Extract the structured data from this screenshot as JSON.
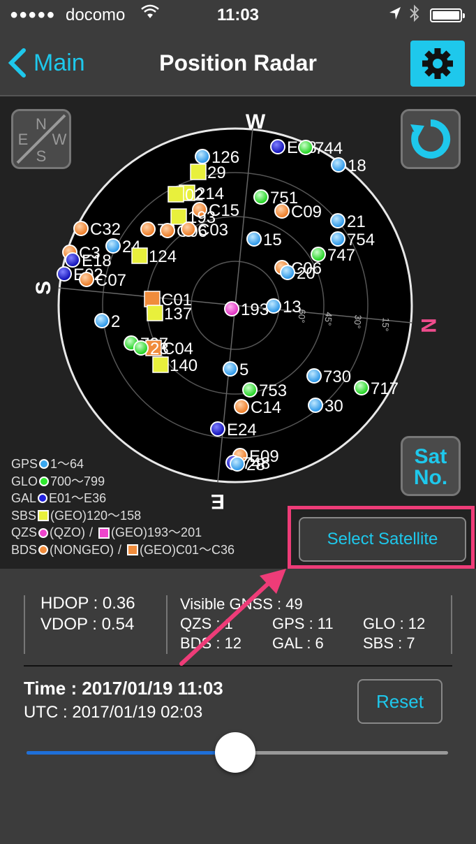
{
  "status_bar": {
    "signal": "●●●●●",
    "carrier": "docomo",
    "time": "11:03"
  },
  "nav": {
    "back_label": "Main",
    "title": "Position Radar",
    "settings_icon": "gear-icon"
  },
  "radar": {
    "directions": {
      "top": "W",
      "right": "N",
      "bottom": "E",
      "left": "S"
    },
    "elevation_labels": [
      "60°",
      "45°",
      "30°",
      "15°"
    ],
    "compass_button_letters": {
      "n": "N",
      "e": "E",
      "s": "S",
      "w": "W"
    },
    "satno_label_1": "Sat",
    "satno_label_2": "No.",
    "satellites": [
      {
        "label": "126",
        "type": "gps"
      },
      {
        "label": "E08",
        "type": "gal"
      },
      {
        "label": "744",
        "type": "glo"
      },
      {
        "label": "18",
        "type": "gps"
      },
      {
        "label": "29",
        "type": "sbs"
      },
      {
        "label": "214",
        "type": "sbs"
      },
      {
        "label": "02",
        "type": "sbs"
      },
      {
        "label": "751",
        "type": "glo"
      },
      {
        "label": "C15",
        "type": "bds"
      },
      {
        "label": "193",
        "type": "sbs"
      },
      {
        "label": "C09",
        "type": "bds"
      },
      {
        "label": "21",
        "type": "gps"
      },
      {
        "label": "C32",
        "type": "bds"
      },
      {
        "label": "73",
        "type": "bds"
      },
      {
        "label": "C06",
        "type": "bds"
      },
      {
        "label": "C03",
        "type": "bds"
      },
      {
        "label": "15",
        "type": "gps"
      },
      {
        "label": "754",
        "type": "gps"
      },
      {
        "label": "C3",
        "type": "bds"
      },
      {
        "label": "E18",
        "type": "gal"
      },
      {
        "label": "24",
        "type": "gps"
      },
      {
        "label": "124",
        "type": "sbs"
      },
      {
        "label": "747",
        "type": "glo"
      },
      {
        "label": "E02",
        "type": "gal"
      },
      {
        "label": "C07",
        "type": "bds"
      },
      {
        "label": "C06",
        "type": "bds"
      },
      {
        "label": "20",
        "type": "gps"
      },
      {
        "label": "C01",
        "type": "bds_geo"
      },
      {
        "label": "137",
        "type": "sbs"
      },
      {
        "label": "193",
        "type": "qzs_geo"
      },
      {
        "label": "13",
        "type": "gps"
      },
      {
        "label": "2",
        "type": "gps"
      },
      {
        "label": "727",
        "type": "glo"
      },
      {
        "label": "C04",
        "type": "bds_geo"
      },
      {
        "label": "23",
        "type": "glo"
      },
      {
        "label": "140",
        "type": "sbs"
      },
      {
        "label": "5",
        "type": "gps"
      },
      {
        "label": "730",
        "type": "gps"
      },
      {
        "label": "30",
        "type": "gps"
      },
      {
        "label": "717",
        "type": "glo"
      },
      {
        "label": "753",
        "type": "glo"
      },
      {
        "label": "C14",
        "type": "bds"
      },
      {
        "label": "E24",
        "type": "gal"
      },
      {
        "label": "E09",
        "type": "bds"
      },
      {
        "label": "748",
        "type": "gal"
      },
      {
        "label": "28",
        "type": "gps"
      }
    ]
  },
  "legend": {
    "gps": {
      "name": "GPS",
      "range": "1〜64"
    },
    "glo": {
      "name": "GLO",
      "range": "700〜799"
    },
    "gal": {
      "name": "GAL",
      "range": "E01〜E36"
    },
    "sbs": {
      "name": "SBS",
      "range": "(GEO)120〜158"
    },
    "qzs": {
      "name": "QZS",
      "range1": "(QZO)",
      "sep": "/",
      "range2": "(GEO)193〜201"
    },
    "bds": {
      "name": "BDS",
      "range1": "(NONGEO)",
      "sep": "/",
      "range2": "(GEO)C01〜C36"
    }
  },
  "select_satellite_label": "Select Satellite",
  "stats": {
    "hdop": "HDOP : 0.36",
    "vdop": "VDOP : 0.54",
    "visible": "Visible GNSS : 49",
    "qzs": "QZS : 1",
    "gps": "GPS : 11",
    "glo": "GLO : 12",
    "bds": "BDS : 12",
    "gal": "GAL : 6",
    "sbs": "SBS : 7"
  },
  "time_label": "Time : 2017/01/19 11:03",
  "utc_label": "UTC : 2017/01/19 02:03",
  "reset_label": "Reset",
  "time_slider": {
    "value": 0.5
  },
  "colors": {
    "accent": "#1ec8ec",
    "highlight": "#ee3c78",
    "gps": "#3aa8f0",
    "glo": "#2ee82e",
    "gal": "#2222dd",
    "sbs": "#e8f03c",
    "qzs": "#ee44cc",
    "bds": "#f08c3c"
  }
}
